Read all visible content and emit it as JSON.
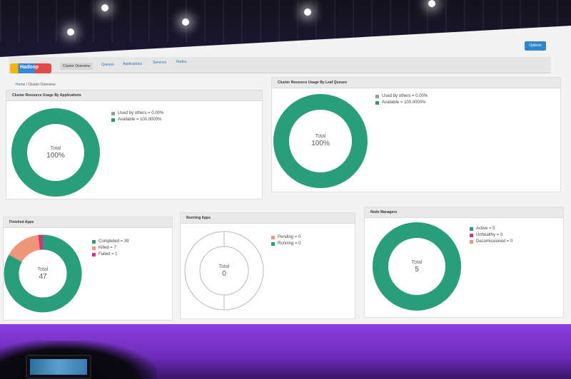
{
  "nav": {
    "logo_text": "Hadoop",
    "tabs": [
      "Cluster Overview",
      "Queues",
      "Applications",
      "Services",
      "Nodes"
    ],
    "active_tab": "Cluster Overview",
    "upgrade_button": "Options"
  },
  "breadcrumb": {
    "home": "Home",
    "sep": "/",
    "current": "Cluster Overview"
  },
  "colors": {
    "green": "#2a9d7a",
    "salmon": "#f0957a",
    "magenta": "#d6327a",
    "gray": "#9a9a9a",
    "outline": "#b9b9b9"
  },
  "panels": {
    "apps_usage": {
      "title": "Cluster Resource Usage By Applications",
      "center_label": "Total",
      "center_value": "100%",
      "legend": [
        "Used by others = 0.00%",
        "Available = 100.0000%"
      ]
    },
    "queues_usage": {
      "title": "Cluster Resource Usage By Leaf Queues",
      "center_label": "Total",
      "center_value": "100%",
      "legend": [
        "Used by others = 0.00%",
        "Available = 100.0000%"
      ]
    },
    "finished": {
      "title": "Finished Apps",
      "center_label": "Total",
      "center_value": "47",
      "legend": [
        "Completed = 39",
        "Killed = 7",
        "Failed = 1"
      ]
    },
    "running": {
      "title": "Running Apps",
      "center_label": "Total",
      "center_value": "0",
      "legend": [
        "Pending = 0",
        "Running = 0"
      ]
    },
    "nodes": {
      "title": "Node Managers",
      "center_label": "Total",
      "center_value": "5",
      "legend": [
        "Active = 5",
        "Unhealthy = 0",
        "Decomissioned = 0"
      ]
    }
  },
  "chart_data": [
    {
      "type": "pie",
      "categories": [
        "Used by others",
        "Available"
      ],
      "values": [
        0,
        100
      ],
      "title": "Cluster Resource Usage By Applications"
    },
    {
      "type": "pie",
      "categories": [
        "Used by others",
        "Available"
      ],
      "values": [
        0,
        100
      ],
      "title": "Cluster Resource Usage By Leaf Queues"
    },
    {
      "type": "pie",
      "categories": [
        "Completed",
        "Killed",
        "Failed"
      ],
      "values": [
        39,
        7,
        1
      ],
      "title": "Finished Apps"
    },
    {
      "type": "pie",
      "categories": [
        "Pending",
        "Running"
      ],
      "values": [
        0,
        0
      ],
      "title": "Running Apps"
    },
    {
      "type": "pie",
      "categories": [
        "Active",
        "Unhealthy",
        "Decomissioned"
      ],
      "values": [
        5,
        0,
        0
      ],
      "title": "Node Managers"
    }
  ]
}
